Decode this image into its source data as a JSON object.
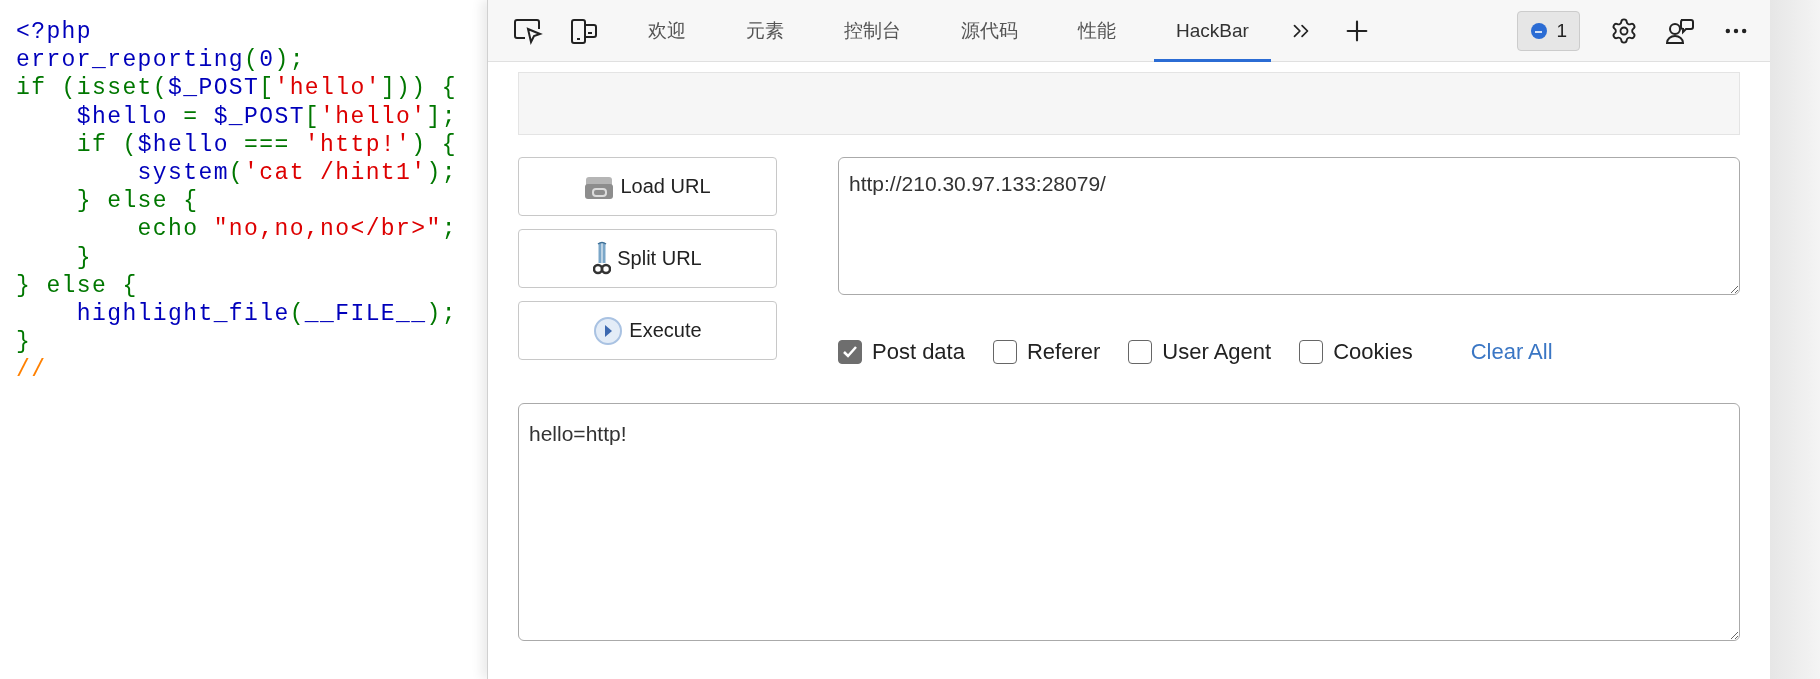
{
  "source_code": {
    "lines": [
      [
        {
          "text": "<?php",
          "color": "#0000bb"
        }
      ],
      [
        {
          "text": "error_reporting",
          "color": "#0000bb"
        },
        {
          "text": "(",
          "color": "#007700"
        },
        {
          "text": "0",
          "color": "#0000bb"
        },
        {
          "text": ");",
          "color": "#007700"
        }
      ],
      [
        {
          "text": "if (isset(",
          "color": "#007700"
        },
        {
          "text": "$_POST",
          "color": "#0000bb"
        },
        {
          "text": "[",
          "color": "#007700"
        },
        {
          "text": "'hello'",
          "color": "#dd0000"
        },
        {
          "text": "])) {",
          "color": "#007700"
        }
      ],
      [
        {
          "text": "    $hello ",
          "color": "#0000bb"
        },
        {
          "text": "= ",
          "color": "#007700"
        },
        {
          "text": "$_POST",
          "color": "#0000bb"
        },
        {
          "text": "[",
          "color": "#007700"
        },
        {
          "text": "'hello'",
          "color": "#dd0000"
        },
        {
          "text": "];",
          "color": "#007700"
        }
      ],
      [
        {
          "text": "    if (",
          "color": "#007700"
        },
        {
          "text": "$hello ",
          "color": "#0000bb"
        },
        {
          "text": "=== ",
          "color": "#007700"
        },
        {
          "text": "'http!'",
          "color": "#dd0000"
        },
        {
          "text": ") {",
          "color": "#007700"
        }
      ],
      [
        {
          "text": "        system",
          "color": "#0000bb"
        },
        {
          "text": "(",
          "color": "#007700"
        },
        {
          "text": "'cat /hint1'",
          "color": "#dd0000"
        },
        {
          "text": ");",
          "color": "#007700"
        }
      ],
      [
        {
          "text": "    } else {",
          "color": "#007700"
        }
      ],
      [
        {
          "text": "        echo ",
          "color": "#007700"
        },
        {
          "text": "\"no,no,no</br>\"",
          "color": "#dd0000"
        },
        {
          "text": ";",
          "color": "#007700"
        }
      ],
      [
        {
          "text": "    }",
          "color": "#007700"
        }
      ],
      [
        {
          "text": "} else {",
          "color": "#007700"
        }
      ],
      [
        {
          "text": "    highlight_file",
          "color": "#0000bb"
        },
        {
          "text": "(",
          "color": "#007700"
        },
        {
          "text": "__FILE__",
          "color": "#0000bb"
        },
        {
          "text": ");",
          "color": "#007700"
        }
      ],
      [
        {
          "text": "}",
          "color": "#007700"
        }
      ],
      [
        {
          "text": "//",
          "color": "#ff8000"
        }
      ]
    ]
  },
  "devtools": {
    "tabs": [
      {
        "label": "欢迎",
        "selected": false
      },
      {
        "label": "元素",
        "selected": false
      },
      {
        "label": "控制台",
        "selected": false
      },
      {
        "label": "源代码",
        "selected": false
      },
      {
        "label": "性能",
        "selected": false
      },
      {
        "label": "HackBar",
        "selected": true
      }
    ],
    "issues_count": "1"
  },
  "hackbar": {
    "buttons": [
      {
        "label": "Load URL",
        "kind": "load"
      },
      {
        "label": "Split URL",
        "kind": "split"
      },
      {
        "label": "Execute",
        "kind": "execute"
      }
    ],
    "url": "http://210.30.97.133:28079/",
    "options": [
      {
        "label": "Post data",
        "checked": true
      },
      {
        "label": "Referer",
        "checked": false
      },
      {
        "label": "User Agent",
        "checked": false
      },
      {
        "label": "Cookies",
        "checked": false
      }
    ],
    "clear_all": "Clear All",
    "post_data": "hello=http!"
  }
}
